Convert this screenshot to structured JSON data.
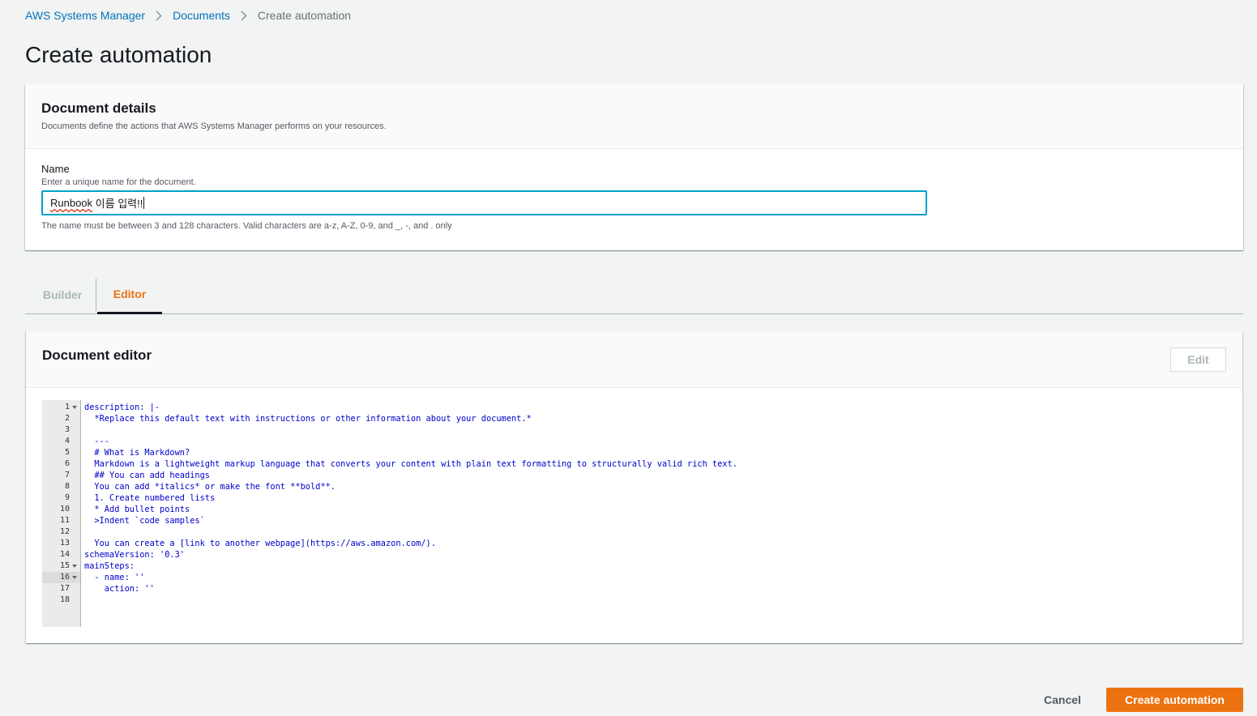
{
  "breadcrumb": {
    "items": [
      "AWS Systems Manager",
      "Documents"
    ],
    "current": "Create automation"
  },
  "page_title": "Create automation",
  "document_details": {
    "title": "Document details",
    "description": "Documents define the actions that AWS Systems Manager performs on your resources.",
    "name_label": "Name",
    "name_description": "Enter a unique name for the document.",
    "name_value_word": "Runbook",
    "name_value_rest": " 이름 입력!!",
    "name_constraint": "The name must be between 3 and 128 characters. Valid characters are a-z, A-Z, 0-9, and _, -, and . only"
  },
  "tabs": {
    "builder": "Builder",
    "editor": "Editor"
  },
  "editor": {
    "title": "Document editor",
    "edit_label": "Edit",
    "lines": [
      "description: |-",
      "  *Replace this default text with instructions or other information about your document.*",
      "",
      "  ---",
      "  # What is Markdown?",
      "  Markdown is a lightweight markup language that converts your content with plain text formatting to structurally valid rich text.",
      "  ## You can add headings",
      "  You can add *italics* or make the font **bold**.",
      "  1. Create numbered lists",
      "  * Add bullet points",
      "  >Indent `code samples`",
      "",
      "  You can create a [link to another webpage](https://aws.amazon.com/).",
      "schemaVersion: '0.3'",
      "mainSteps:",
      "  - name: ''",
      "    action: ''",
      ""
    ],
    "line_numbers": [
      "1",
      "2",
      "3",
      "4",
      "5",
      "6",
      "7",
      "8",
      "9",
      "10",
      "11",
      "12",
      "13",
      "14",
      "15",
      "16",
      "17",
      "18"
    ]
  },
  "footer": {
    "cancel_label": "Cancel",
    "create_label": "Create automation"
  },
  "colors": {
    "accent": "#ec7211",
    "link": "#0073bb",
    "focus": "#00a1c9"
  }
}
